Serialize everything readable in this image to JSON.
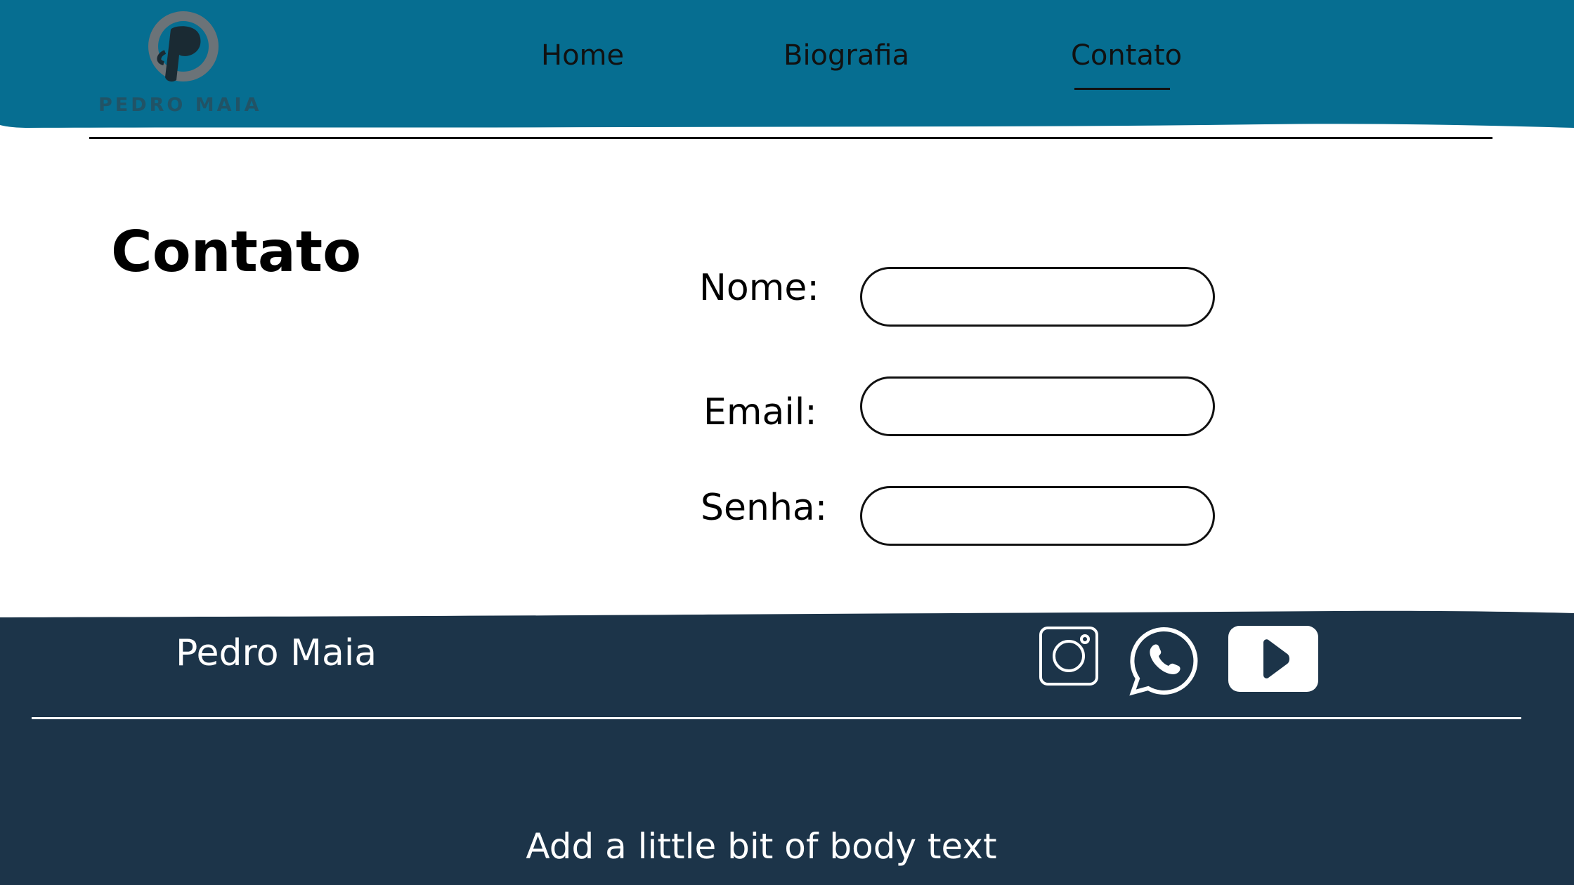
{
  "colors": {
    "header_bg": "#066e91",
    "footer_bg": "#1c3449",
    "text_dark": "#111111",
    "text_light": "#ffffff"
  },
  "header": {
    "logo": {
      "icon": "p-monogram-logo",
      "wordmark": "PEDRO MAIA"
    },
    "nav": [
      {
        "label": "Home",
        "active": false
      },
      {
        "label": "Biografia",
        "active": false
      },
      {
        "label": "Contato",
        "active": true
      }
    ]
  },
  "main": {
    "title": "Contato",
    "form": {
      "fields": [
        {
          "label": "Nome:",
          "value": "",
          "placeholder": ""
        },
        {
          "label": "Email:",
          "value": "",
          "placeholder": ""
        },
        {
          "label": "Senha:",
          "value": "",
          "placeholder": ""
        }
      ]
    }
  },
  "footer": {
    "name": "Pedro Maia",
    "social": [
      {
        "icon": "instagram-icon"
      },
      {
        "icon": "whatsapp-icon"
      },
      {
        "icon": "youtube-icon"
      }
    ],
    "body_text": "Add a little bit of body text"
  }
}
